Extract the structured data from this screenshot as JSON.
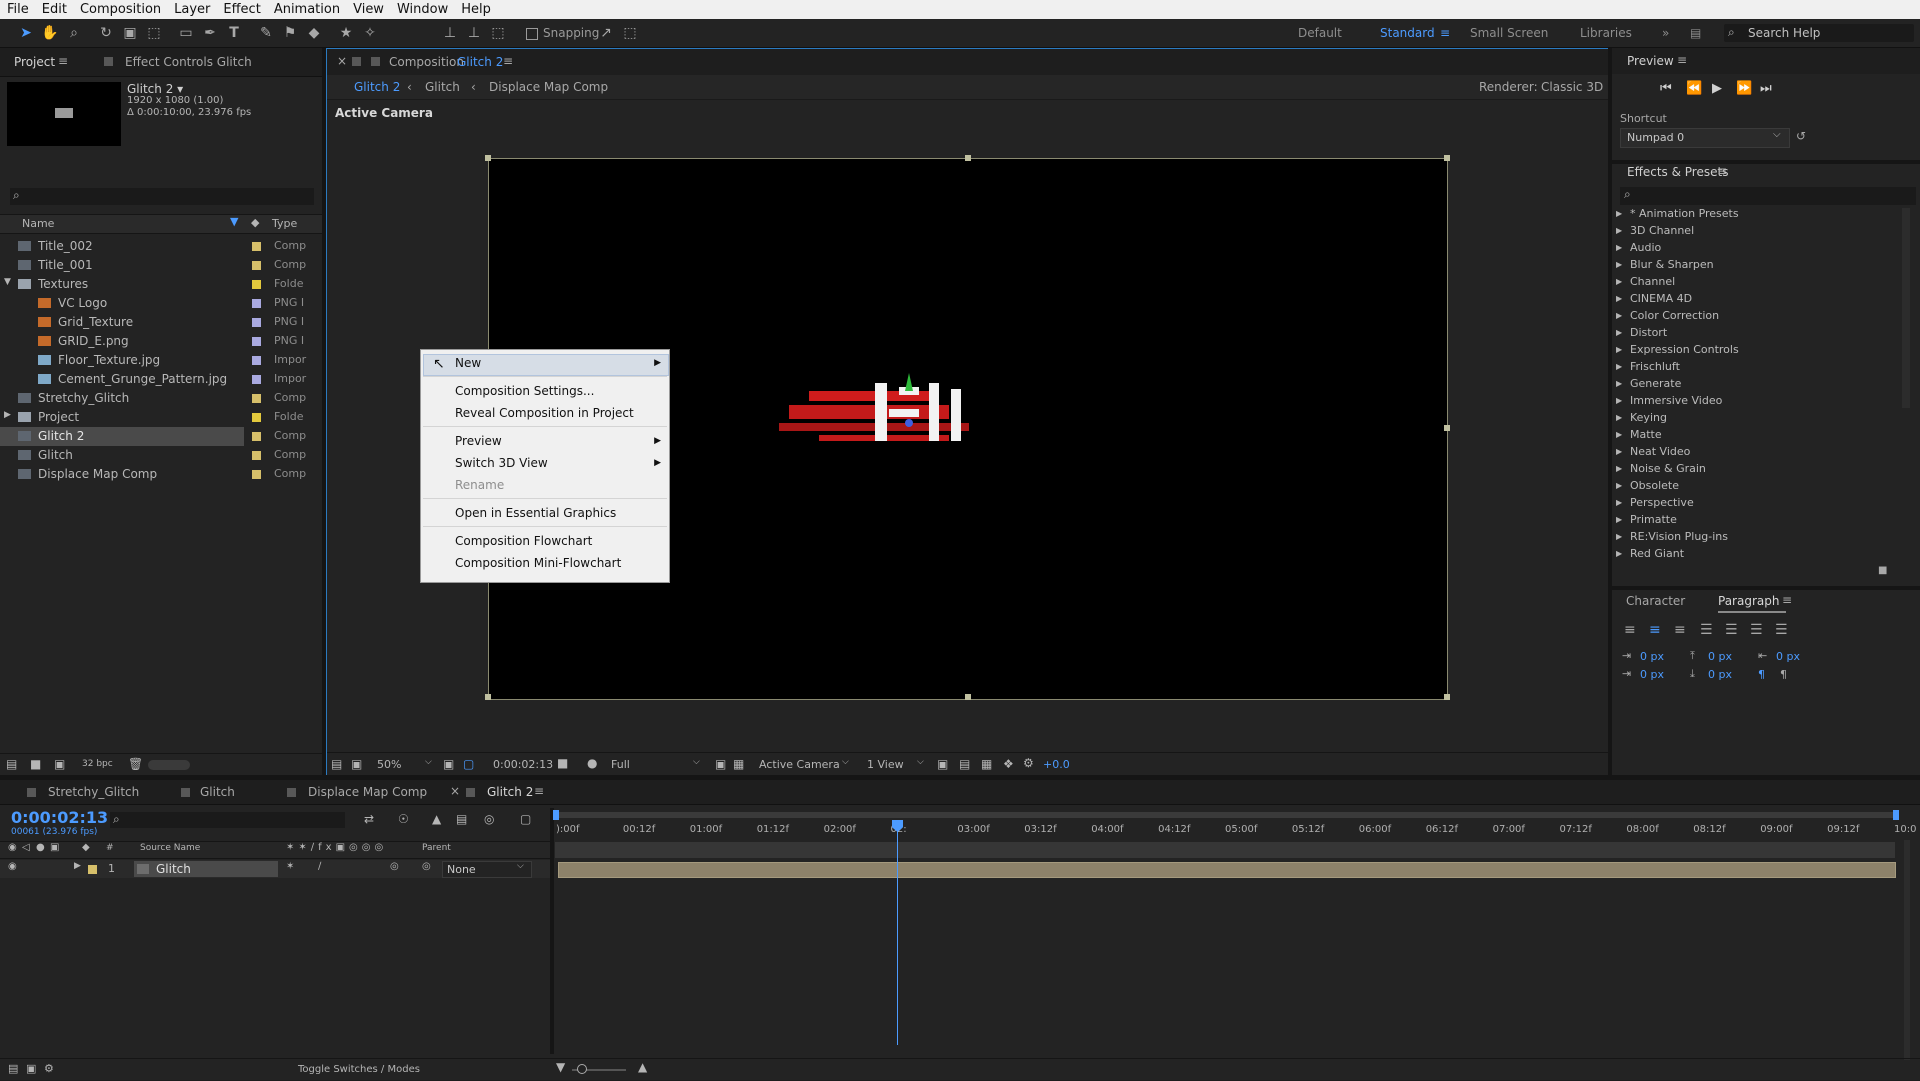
{
  "menubar": [
    "File",
    "Edit",
    "Composition",
    "Layer",
    "Effect",
    "Animation",
    "View",
    "Window",
    "Help"
  ],
  "toolbar": {
    "snapping": "Snapping",
    "workspaces": [
      "Default",
      "Standard",
      "Small Screen",
      "Libraries"
    ],
    "active_workspace": "Standard",
    "search_placeholder": "Search Help"
  },
  "project": {
    "tab_project": "Project",
    "tab_effect_controls": "Effect Controls Glitch",
    "comp_name": "Glitch 2 ▾",
    "comp_res": "1920 x 1080 (1.00)",
    "comp_dur": "Δ 0:00:10:00, 23.976 fps",
    "col_name": "Name",
    "col_type": "Type",
    "bpc": "32 bpc",
    "items": [
      {
        "name": "Title_002",
        "type": "Comp",
        "indent": 0,
        "color": "#d6bf6a",
        "kind": "comp"
      },
      {
        "name": "Title_001",
        "type": "Comp",
        "indent": 0,
        "color": "#d6bf6a",
        "kind": "comp"
      },
      {
        "name": "Textures",
        "type": "Folde",
        "indent": 0,
        "color": "#e3c93d",
        "kind": "folder",
        "open": true
      },
      {
        "name": "VC Logo",
        "type": "PNG I",
        "indent": 1,
        "color": "#a9a9e0",
        "kind": "img"
      },
      {
        "name": "Grid_Texture",
        "type": "PNG I",
        "indent": 1,
        "color": "#a9a9e0",
        "kind": "img"
      },
      {
        "name": "GRID_E.png",
        "type": "PNG I",
        "indent": 1,
        "color": "#a9a9e0",
        "kind": "img"
      },
      {
        "name": "Floor_Texture.jpg",
        "type": "Impor",
        "indent": 1,
        "color": "#a9a9e0",
        "kind": "img2"
      },
      {
        "name": "Cement_Grunge_Pattern.jpg",
        "type": "Impor",
        "indent": 1,
        "color": "#a9a9e0",
        "kind": "img2"
      },
      {
        "name": "Stretchy_Glitch",
        "type": "Comp",
        "indent": 0,
        "color": "#d6bf6a",
        "kind": "comp"
      },
      {
        "name": "Project",
        "type": "Folde",
        "indent": 0,
        "color": "#e3c93d",
        "kind": "folder",
        "open": false
      },
      {
        "name": "Glitch 2",
        "type": "Comp",
        "indent": 0,
        "color": "#d6bf6a",
        "kind": "comp",
        "selected": true
      },
      {
        "name": "Glitch",
        "type": "Comp",
        "indent": 0,
        "color": "#d6bf6a",
        "kind": "comp"
      },
      {
        "name": "Displace Map Comp",
        "type": "Comp",
        "indent": 0,
        "color": "#d6bf6a",
        "kind": "comp"
      }
    ]
  },
  "composition": {
    "tab_label": "Composition",
    "tab_name": "Glitch 2",
    "crumbs": [
      "Glitch 2",
      "Glitch",
      "Displace Map Comp"
    ],
    "renderer_label": "Renderer:",
    "renderer": "Classic 3D",
    "active_camera": "Active Camera",
    "zoom": "50%",
    "timecode": "0:00:02:13",
    "resolution": "Full",
    "camera": "Active Camera",
    "views": "1 View",
    "exposure": "+0.0"
  },
  "context_menu": {
    "items": [
      {
        "label": "New",
        "submenu": true,
        "highlight": true
      },
      {
        "label": "Composition Settings..."
      },
      {
        "label": "Reveal Composition in Project"
      },
      {
        "label": "Preview",
        "submenu": true
      },
      {
        "label": "Switch 3D View",
        "submenu": true
      },
      {
        "label": "Rename",
        "disabled": true
      },
      {
        "label": "Open in Essential Graphics"
      },
      {
        "label": "Composition Flowchart"
      },
      {
        "label": "Composition Mini-Flowchart"
      }
    ]
  },
  "preview": {
    "title": "Preview",
    "shortcut_label": "Shortcut",
    "shortcut_value": "Numpad 0"
  },
  "effects": {
    "title": "Effects & Presets",
    "items": [
      "* Animation Presets",
      "3D Channel",
      "Audio",
      "Blur & Sharpen",
      "Channel",
      "CINEMA 4D",
      "Color Correction",
      "Distort",
      "Expression Controls",
      "Frischluft",
      "Generate",
      "Immersive Video",
      "Keying",
      "Matte",
      "Neat Video",
      "Noise & Grain",
      "Obsolete",
      "Perspective",
      "Primatte",
      "RE:Vision Plug-ins",
      "Red Giant"
    ]
  },
  "paragraph": {
    "tab_character": "Character",
    "tab_paragraph": "Paragraph",
    "values": [
      "0 px",
      "0 px",
      "0 px",
      "0 px",
      "0 px"
    ]
  },
  "timeline": {
    "tabs": [
      "Stretchy_Glitch",
      "Glitch",
      "Displace Map Comp",
      "Glitch 2"
    ],
    "active_tab": "Glitch 2",
    "timecode": "0:00:02:13",
    "frames": "00061 (23.976 fps)",
    "col_source": "Source Name",
    "col_parent": "Parent",
    "layer_num": "1",
    "layer_name": "Glitch",
    "parent_value": "None",
    "ruler": [
      "):00f",
      "00:12f",
      "01:00f",
      "01:12f",
      "02:00f",
      "02:",
      "03:00f",
      "03:12f",
      "04:00f",
      "04:12f",
      "05:00f",
      "05:12f",
      "06:00f",
      "06:12f",
      "07:00f",
      "07:12f",
      "08:00f",
      "08:12f",
      "09:00f",
      "09:12f",
      "10:0"
    ],
    "toggle_label": "Toggle Switches / Modes"
  }
}
